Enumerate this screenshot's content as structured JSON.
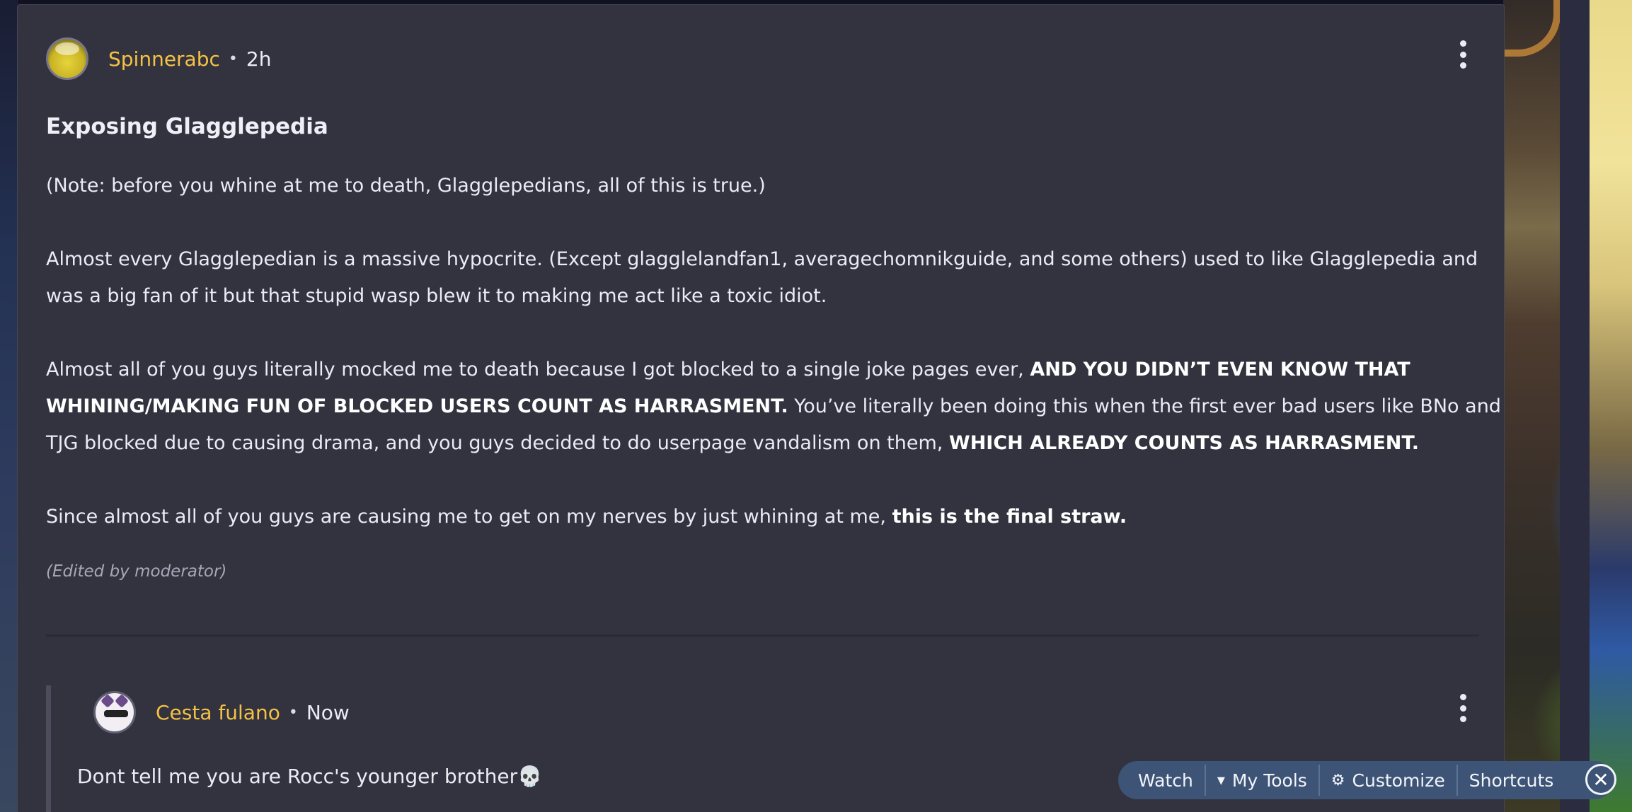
{
  "post": {
    "author": "Spinnerabc",
    "separator": "•",
    "time": "2h",
    "title": "Exposing Glagglepedia",
    "p1": "(Note: before you whine at me to death, Glagglepedians, all of this is true.)",
    "p2": "Almost every Glagglepedian is a massive hypocrite. (Except glagglelandfan1, averagechomnikguide, and some others) used to like Glagglepedia and was a big fan of it but that stupid wasp blew it to making me act like a toxic idiot.",
    "p3_a": "Almost all of you guys literally mocked me to death because I got blocked to a single joke pages ever, ",
    "p3_b": "AND YOU DIDN’T EVEN KNOW THAT WHINING/MAKING FUN OF BLOCKED USERS COUNT AS HARRASMENT.",
    "p3_c": " You’ve literally been doing this when the first ever bad users like BNo and TJG blocked due to causing drama, and you guys decided to do userpage vandalism on them, ",
    "p3_d": "WHICH ALREADY COUNTS AS HARRASMENT.",
    "p4_a": "Since almost all of you guys are causing me to get on my nerves by just whining at me, ",
    "p4_b": "this is the final straw.",
    "edited": "(Edited by moderator)"
  },
  "reply": {
    "author": "Cesta fulano",
    "separator": "•",
    "time": "Now",
    "text": "Dont tell me you are Rocc's younger brother💀"
  },
  "toolbar": {
    "watch": "Watch",
    "my_tools": "My Tools",
    "my_tools_icon": "caret-down-icon",
    "customize": "Customize",
    "customize_icon": "gear-icon",
    "shortcuts": "Shortcuts",
    "close_icon": "close-icon"
  },
  "colors": {
    "card_bg": "#33333f",
    "username": "#f5c244",
    "toolbar_bg": "#3d5477"
  }
}
